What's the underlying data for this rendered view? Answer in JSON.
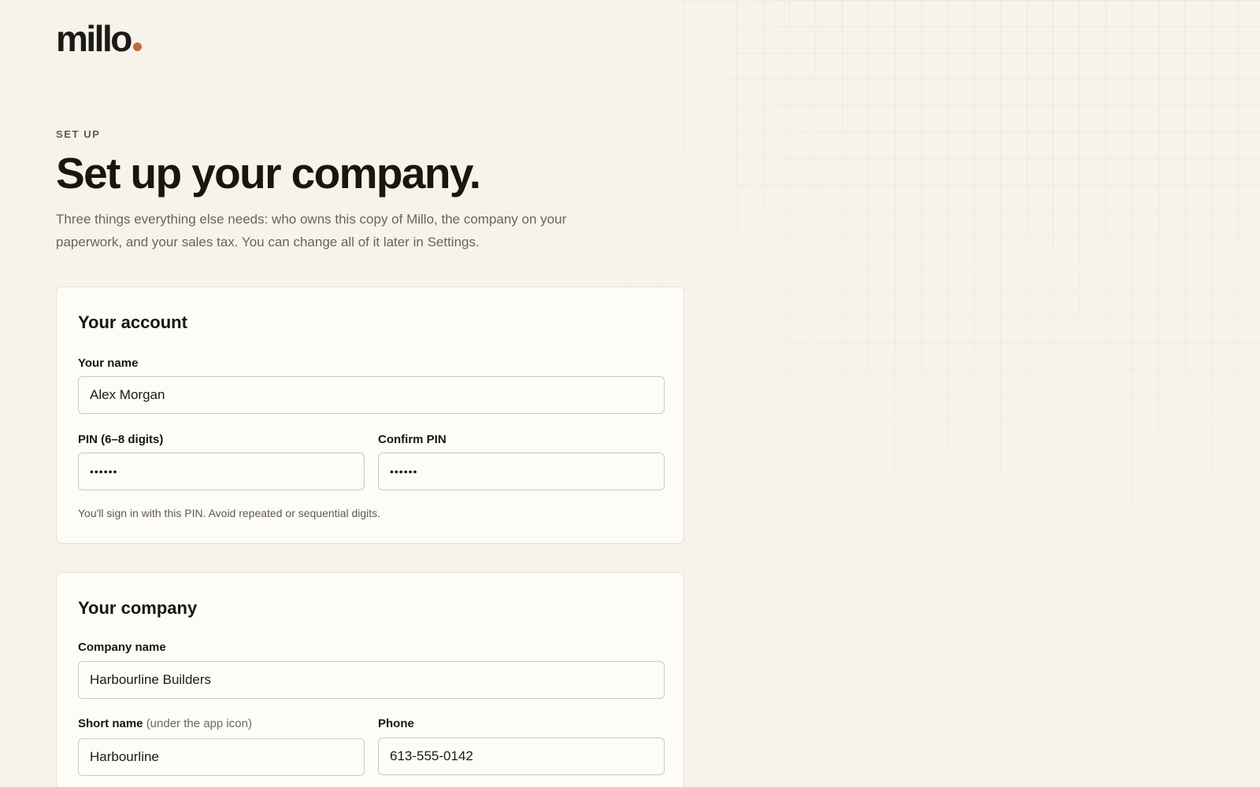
{
  "brand": {
    "name": "millo",
    "dot_color": "#c4693f"
  },
  "header": {
    "eyebrow": "SET UP",
    "title": "Set up your company.",
    "intro": "Three things everything else needs: who owns this copy of Millo, the company on your paperwork, and your sales tax. You can change all of it later in Settings."
  },
  "account": {
    "title": "Your account",
    "name_label": "Your name",
    "name_value": "Alex Morgan",
    "pin_label": "PIN (6–8 digits)",
    "pin_value": "••••••",
    "confirm_pin_label": "Confirm PIN",
    "confirm_pin_value": "••••••",
    "pin_helper": "You'll sign in with this PIN. Avoid repeated or sequential digits."
  },
  "company": {
    "title": "Your company",
    "company_name_label": "Company name",
    "company_name_value": "Harbourline Builders",
    "short_name_label": "Short name",
    "short_name_hint": "(under the app icon)",
    "short_name_value": "Harbourline",
    "phone_label": "Phone",
    "phone_value": "613-555-0142"
  },
  "colors": {
    "background": "#f7f3ea",
    "card": "#fdfcf7",
    "accent": "#c4693f"
  }
}
